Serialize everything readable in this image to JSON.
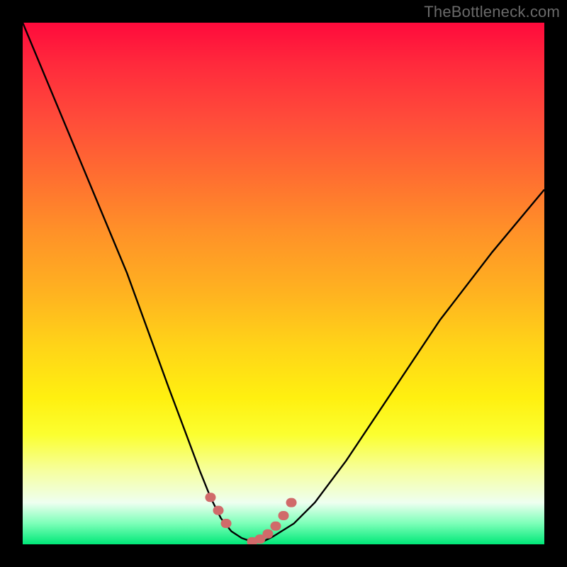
{
  "attribution": "TheBottleneck.com",
  "chart_data": {
    "type": "line",
    "title": "",
    "xlabel": "",
    "ylabel": "",
    "xlim": [
      0,
      100
    ],
    "ylim": [
      0,
      100
    ],
    "series": [
      {
        "name": "curve",
        "x": [
          0,
          5,
          10,
          15,
          20,
          24,
          28,
          31,
          34,
          36,
          38,
          40,
          42,
          44,
          46,
          48,
          52,
          56,
          62,
          70,
          80,
          90,
          100
        ],
        "y": [
          100,
          88,
          76,
          64,
          52,
          41,
          30,
          22,
          14,
          9,
          5,
          2.5,
          1.2,
          0.5,
          0.5,
          1.5,
          4,
          8,
          16,
          28,
          43,
          56,
          68
        ]
      },
      {
        "name": "dotted-segments",
        "x": [
          36,
          37.5,
          39,
          44,
          45.5,
          47,
          48.5,
          50,
          51.5
        ],
        "y": [
          9,
          6.5,
          4,
          0.5,
          1,
          2,
          3.5,
          5.5,
          8
        ]
      }
    ],
    "colors": {
      "curve_stroke": "#000000",
      "dots_stroke": "#d06a6a",
      "gradient_stops": [
        "#ff0a3c",
        "#ff2a3c",
        "#ff4a3a",
        "#ff7030",
        "#ff9128",
        "#ffb320",
        "#ffd418",
        "#fff010",
        "#fbff30",
        "#f6ffa0",
        "#eefff0",
        "#7cffb8",
        "#00e878"
      ]
    }
  }
}
